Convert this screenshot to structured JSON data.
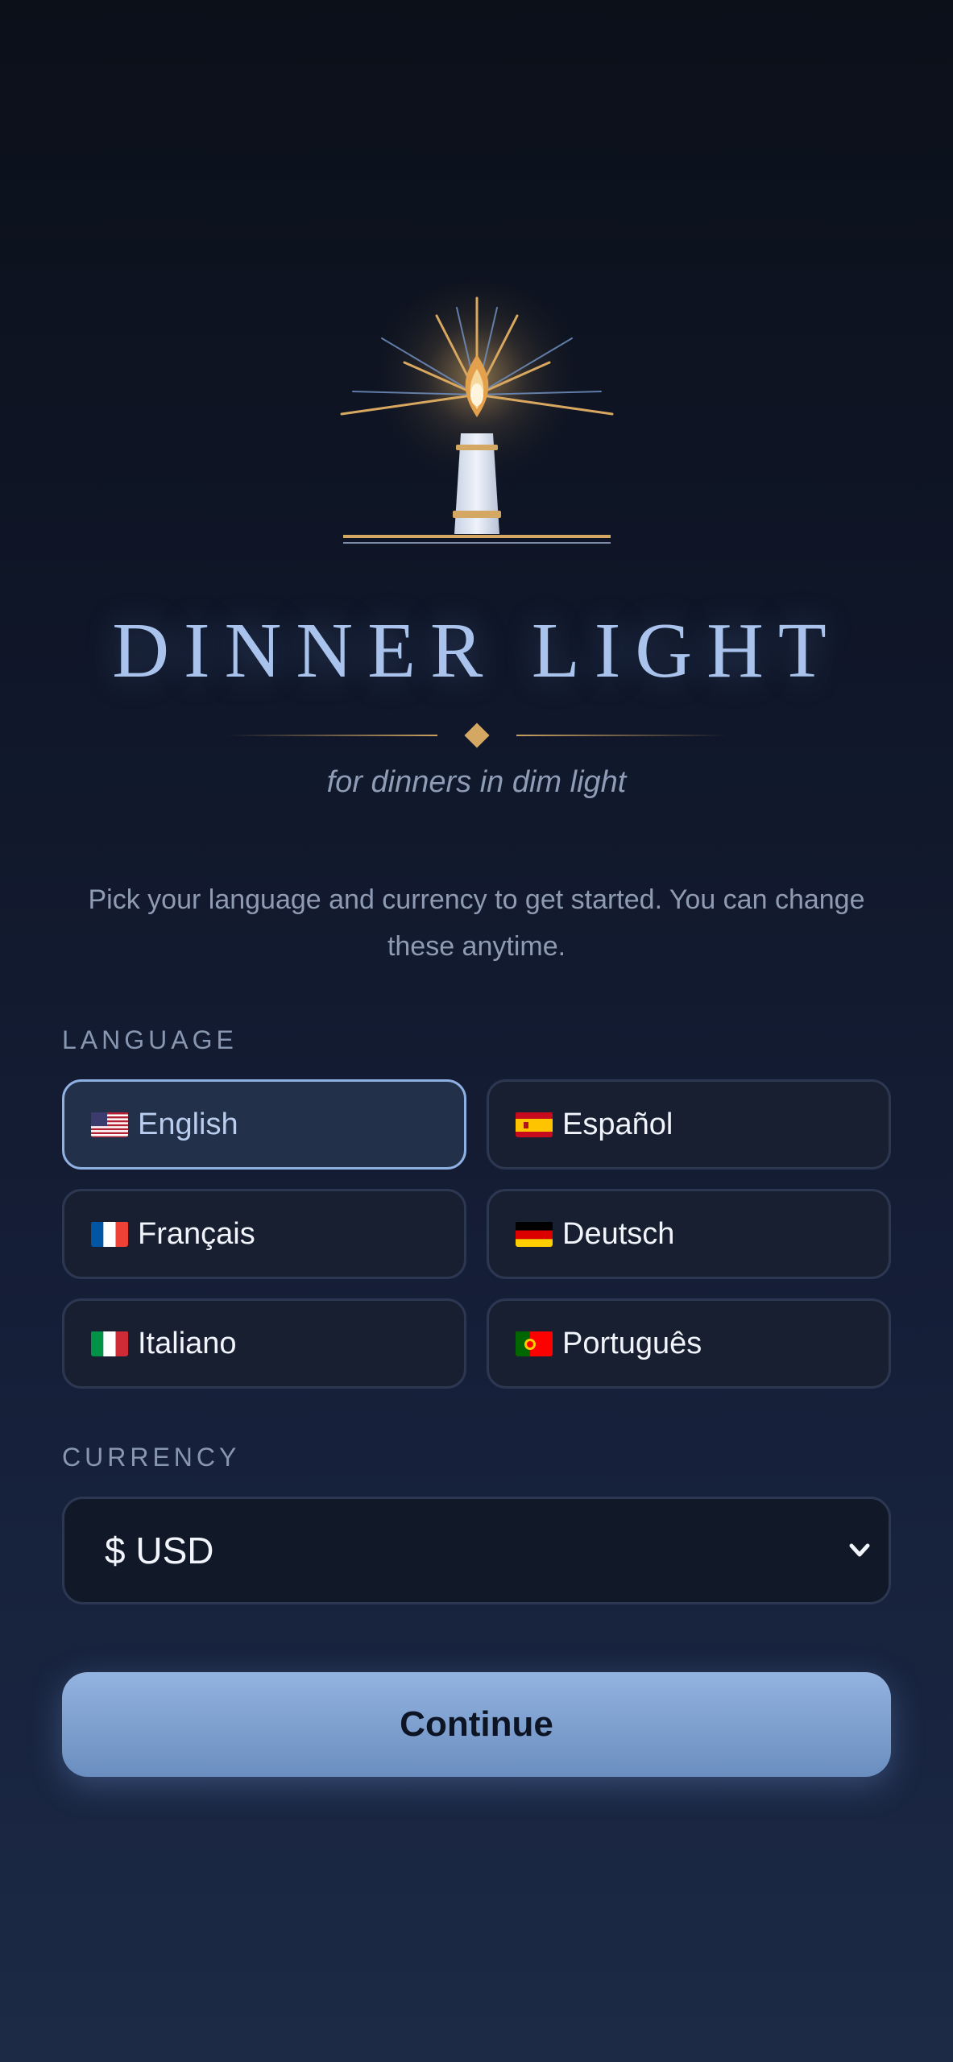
{
  "brand": {
    "title": "DINNER LIGHT",
    "tagline": "for dinners in dim light",
    "logo_icon": "lighthouse-icon"
  },
  "intro_text": "Pick your language and currency to get started. You can change these anytime.",
  "language": {
    "label": "LANGUAGE",
    "selected": "English",
    "options": [
      {
        "label": "English",
        "flag": "us-flag-icon"
      },
      {
        "label": "Español",
        "flag": "es-flag-icon"
      },
      {
        "label": "Français",
        "flag": "fr-flag-icon"
      },
      {
        "label": "Deutsch",
        "flag": "de-flag-icon"
      },
      {
        "label": "Italiano",
        "flag": "it-flag-icon"
      },
      {
        "label": "Português",
        "flag": "pt-flag-icon"
      }
    ]
  },
  "currency": {
    "label": "CURRENCY",
    "selected": "$ USD"
  },
  "continue_label": "Continue",
  "colors": {
    "accent_gold": "#d4a862",
    "accent_blue": "#8fb0e3",
    "title_blue": "#a9c3ec",
    "background_top": "#0b1019",
    "background_bottom": "#1c2a46"
  }
}
